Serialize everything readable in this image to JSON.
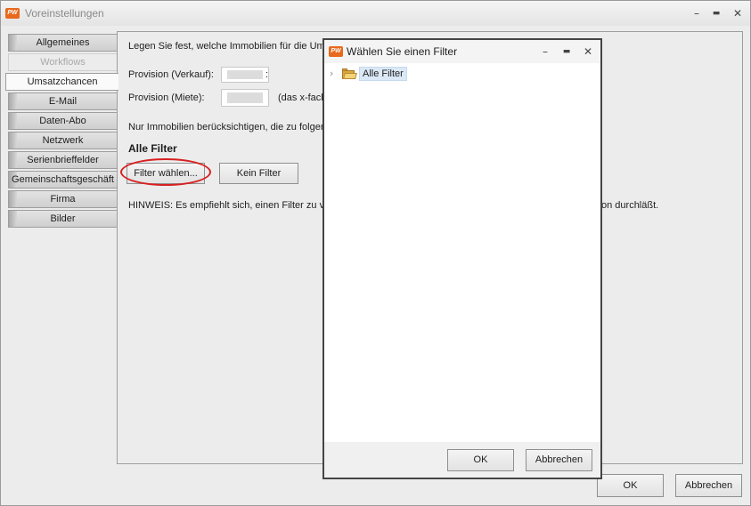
{
  "window": {
    "app_logo": "PW",
    "title": "Voreinstellungen",
    "minimize_glyph": "–",
    "maximize_glyph": "▬",
    "close_glyph": "✕"
  },
  "tabs": [
    {
      "label": "Allgemeines",
      "state": "normal"
    },
    {
      "label": "Workflows",
      "state": "disabled"
    },
    {
      "label": "Umsatzchancen",
      "state": "active"
    },
    {
      "label": "E-Mail",
      "state": "normal"
    },
    {
      "label": "Daten-Abo",
      "state": "normal"
    },
    {
      "label": "Netzwerk",
      "state": "normal"
    },
    {
      "label": "Serienbrieffelder",
      "state": "normal"
    },
    {
      "label": "Gemeinschaftsgeschäft",
      "state": "normal"
    },
    {
      "label": "Firma",
      "state": "normal"
    },
    {
      "label": "Bilder",
      "state": "normal"
    }
  ],
  "panel": {
    "intro_text": "Legen Sie fest, welche Immobilien für die Ums",
    "provision_sale_label": "Provision (Verkauf):",
    "provision_sale_suffix": ":",
    "provision_rent_label": "Provision (Miete):",
    "provision_rent_hint": "(das x-fach",
    "filter_intro": "Nur Immobilien berücksichtigen, die zu folgend",
    "filter_heading": "Alle Filter",
    "choose_filter_button": "Filter wählen...",
    "no_filter_button": "Kein Filter",
    "note_left": "HINWEIS: Es empfiehlt sich, einen Filter zu ve",
    "note_right": "on durchläßt."
  },
  "footer": {
    "ok_button": "OK",
    "cancel_button": "Abbrechen"
  },
  "dialog": {
    "app_logo": "PW",
    "title": "Wählen Sie einen Filter",
    "minimize_glyph": "–",
    "maximize_glyph": "▬",
    "close_glyph": "✕",
    "tree_expander": "›",
    "tree_root_label": "Alle Filter",
    "ok_button": "OK",
    "cancel_button": "Abbrechen"
  },
  "colors": {
    "highlight_ring": "#d82020",
    "app_logo": "#e8691d",
    "selection": "#dbe8f6"
  },
  "icons": [
    "app-logo-icon",
    "minimize-icon",
    "maximize-icon",
    "close-icon",
    "expand-arrow-icon",
    "folder-icon"
  ]
}
